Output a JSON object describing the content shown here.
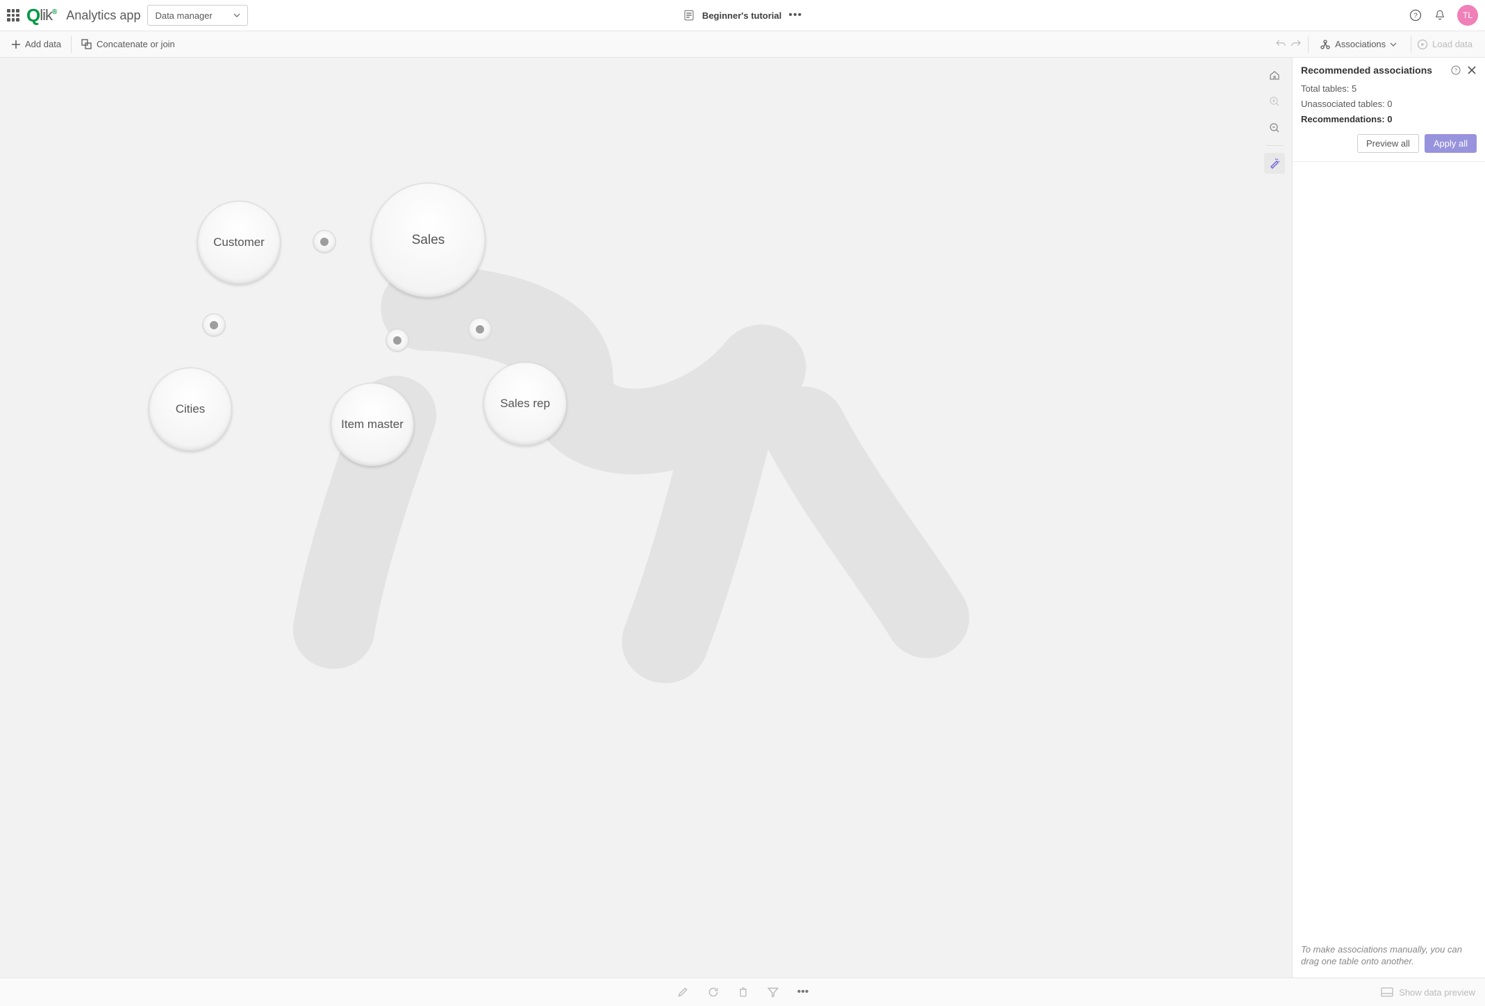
{
  "topbar": {
    "app_name": "Analytics app",
    "view_dropdown": "Data manager",
    "breadcrumb": "Beginner's tutorial",
    "avatar_initials": "TL"
  },
  "actionbar": {
    "add_data": "Add data",
    "concat": "Concatenate or join",
    "associations": "Associations",
    "load_data": "Load data"
  },
  "canvas": {
    "tables": {
      "customer": "Customer",
      "sales": "Sales",
      "cities": "Cities",
      "item_master": "Item master",
      "sales_rep": "Sales rep"
    }
  },
  "panel": {
    "title": "Recommended associations",
    "total_label": "Total tables: ",
    "total_value": "5",
    "unassoc_label": "Unassociated tables: ",
    "unassoc_value": "0",
    "rec_label": "Recommendations: ",
    "rec_value": "0",
    "preview_all": "Preview all",
    "apply_all": "Apply all",
    "hint": "To make associations manually, you can drag one table onto another."
  },
  "bottombar": {
    "show_preview": "Show data preview"
  }
}
